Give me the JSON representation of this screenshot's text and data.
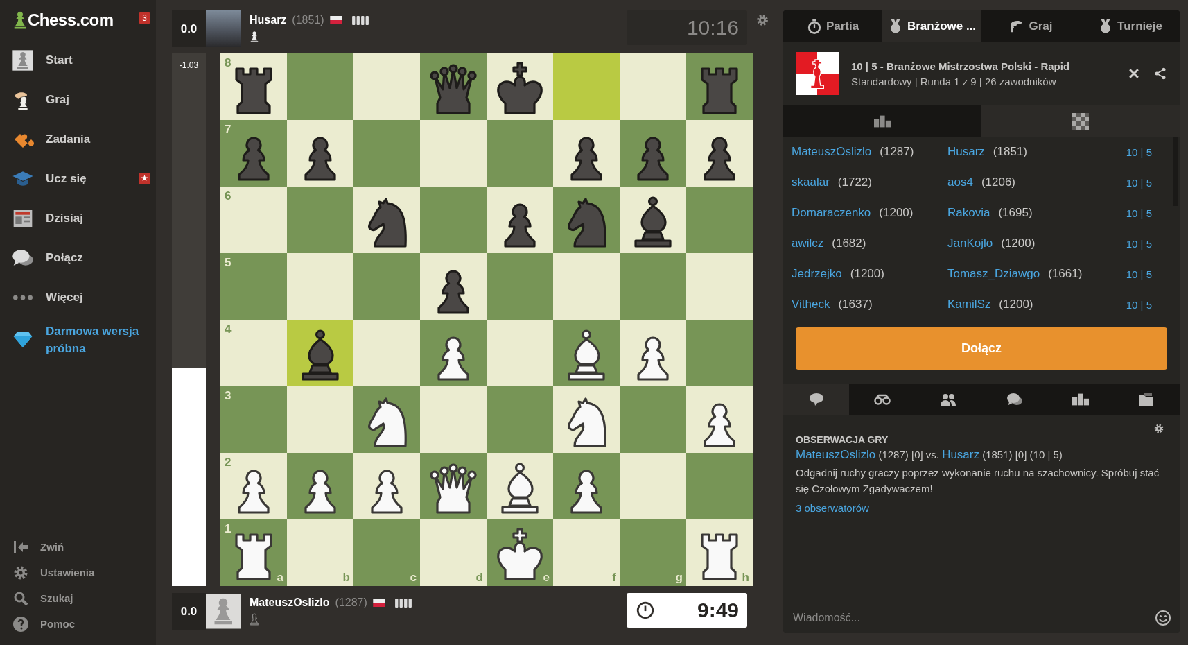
{
  "sidebar": {
    "logo": "Chess.com",
    "notification_count": "3",
    "items": [
      {
        "label": "Start",
        "starred": false
      },
      {
        "label": "Graj",
        "starred": false
      },
      {
        "label": "Zadania",
        "starred": false
      },
      {
        "label": "Ucz się",
        "starred": true
      },
      {
        "label": "Dzisiaj",
        "starred": false
      },
      {
        "label": "Połącz",
        "starred": false
      },
      {
        "label": "Więcej",
        "starred": false
      }
    ],
    "promo": "Darmowa wersja próbna",
    "footer": [
      {
        "label": "Zwiń"
      },
      {
        "label": "Ustawienia"
      },
      {
        "label": "Szukaj"
      },
      {
        "label": "Pomoc"
      }
    ]
  },
  "top_player": {
    "score": "0.0",
    "name": "Husarz",
    "rating": "(1851)",
    "clock": "10:16",
    "active": false
  },
  "eval_bar": {
    "reading": "-1.03",
    "level": 0.41
  },
  "board": {
    "rank_labels": [
      "8",
      "7",
      "6",
      "5",
      "4",
      "3",
      "2",
      "1"
    ],
    "file_labels": [
      "a",
      "b",
      "c",
      "d",
      "e",
      "f",
      "g",
      "h"
    ],
    "rows": [
      [
        {
          "kind": "rook",
          "white": false,
          "highlighted": false
        },
        {
          "highlighted": false
        },
        {
          "highlighted": false
        },
        {
          "kind": "queen",
          "white": false,
          "highlighted": false
        },
        {
          "kind": "king",
          "white": false,
          "highlighted": false
        },
        {
          "highlighted": true
        },
        {
          "highlighted": false
        },
        {
          "kind": "rook",
          "white": false,
          "highlighted": false
        }
      ],
      [
        {
          "kind": "pawn",
          "white": false,
          "highlighted": false
        },
        {
          "kind": "pawn",
          "white": false,
          "highlighted": false
        },
        {
          "highlighted": false
        },
        {
          "highlighted": false
        },
        {
          "highlighted": false
        },
        {
          "kind": "pawn",
          "white": false,
          "highlighted": false
        },
        {
          "kind": "pawn",
          "white": false,
          "highlighted": false
        },
        {
          "kind": "pawn",
          "white": false,
          "highlighted": false
        }
      ],
      [
        {
          "highlighted": false
        },
        {
          "highlighted": false
        },
        {
          "kind": "knight",
          "white": false,
          "highlighted": false
        },
        {
          "highlighted": false
        },
        {
          "kind": "pawn",
          "white": false,
          "highlighted": false
        },
        {
          "kind": "knight",
          "white": false,
          "highlighted": false
        },
        {
          "kind": "bishop",
          "white": false,
          "highlighted": false
        },
        {
          "highlighted": false
        }
      ],
      [
        {
          "highlighted": false
        },
        {
          "highlighted": false
        },
        {
          "highlighted": false
        },
        {
          "kind": "pawn",
          "white": false,
          "highlighted": false
        },
        {
          "highlighted": false
        },
        {
          "highlighted": false
        },
        {
          "highlighted": false
        },
        {
          "highlighted": false
        }
      ],
      [
        {
          "highlighted": false
        },
        {
          "kind": "bishop",
          "white": false,
          "highlighted": true
        },
        {
          "highlighted": false
        },
        {
          "kind": "pawn",
          "white": true,
          "highlighted": false
        },
        {
          "highlighted": false
        },
        {
          "kind": "bishop",
          "white": true,
          "highlighted": false
        },
        {
          "kind": "pawn",
          "white": true,
          "highlighted": false
        },
        {
          "highlighted": false
        }
      ],
      [
        {
          "highlighted": false
        },
        {
          "highlighted": false
        },
        {
          "kind": "knight",
          "white": true,
          "highlighted": false
        },
        {
          "highlighted": false
        },
        {
          "highlighted": false
        },
        {
          "kind": "knight",
          "white": true,
          "highlighted": false
        },
        {
          "highlighted": false
        },
        {
          "kind": "pawn",
          "white": true,
          "highlighted": false
        }
      ],
      [
        {
          "kind": "pawn",
          "white": true,
          "highlighted": false
        },
        {
          "kind": "pawn",
          "white": true,
          "highlighted": false
        },
        {
          "kind": "pawn",
          "white": true,
          "highlighted": false
        },
        {
          "kind": "queen",
          "white": true,
          "highlighted": false
        },
        {
          "kind": "bishop",
          "white": true,
          "highlighted": false
        },
        {
          "kind": "pawn",
          "white": true,
          "highlighted": false
        },
        {
          "highlighted": false
        },
        {
          "highlighted": false
        }
      ],
      [
        {
          "kind": "rook",
          "white": true,
          "highlighted": false
        },
        {
          "highlighted": false
        },
        {
          "highlighted": false
        },
        {
          "highlighted": false
        },
        {
          "kind": "king",
          "white": true,
          "highlighted": false
        },
        {
          "highlighted": false
        },
        {
          "highlighted": false
        },
        {
          "kind": "rook",
          "white": true,
          "highlighted": false
        }
      ]
    ]
  },
  "bottom_player": {
    "score": "0.0",
    "name": "MateuszOslizlo",
    "rating": "(1287)",
    "clock": "9:49",
    "active": true
  },
  "right_panel": {
    "tabs": [
      {
        "label": "Partia",
        "selected": false
      },
      {
        "label": "Branżowe ...",
        "selected": true
      },
      {
        "label": "Graj",
        "selected": false
      },
      {
        "label": "Turnieje",
        "selected": false
      }
    ],
    "tournament": {
      "title": "10 | 5 - Branżowe Mistrzostwa Polski - Rapid",
      "subtitle": "Standardowy | Runda 1 z 9 | 26 zawodników"
    },
    "subtabs": [
      {
        "selected": false
      },
      {
        "selected": true
      }
    ],
    "pairings": [
      {
        "white": "MateuszOslizlo",
        "white_rating": "(1287)",
        "black": "Husarz",
        "black_rating": "(1851)",
        "time": "10 | 5"
      },
      {
        "white": "skaalar",
        "white_rating": "(1722)",
        "black": "aos4",
        "black_rating": "(1206)",
        "time": "10 | 5"
      },
      {
        "white": "Domaraczenko",
        "white_rating": "(1200)",
        "black": "Rakovia",
        "black_rating": "(1695)",
        "time": "10 | 5"
      },
      {
        "white": "awilcz",
        "white_rating": "(1682)",
        "black": "JanKojlo",
        "black_rating": "(1200)",
        "time": "10 | 5"
      },
      {
        "white": "Jedrzejko",
        "white_rating": "(1200)",
        "black": "Tomasz_Dziawgo",
        "black_rating": "(1661)",
        "time": "10 | 5"
      },
      {
        "white": "Vitheck",
        "white_rating": "(1637)",
        "black": "KamilSz",
        "black_rating": "(1200)",
        "time": "10 | 5"
      }
    ],
    "join_button": "Dołącz",
    "chat_tabs": [
      {
        "selected": true
      },
      {
        "selected": false
      },
      {
        "selected": false
      },
      {
        "selected": false
      },
      {
        "selected": false
      },
      {
        "selected": false
      }
    ],
    "chat": {
      "heading": "OBSERWACJA GRY",
      "white": "MateuszOslizlo",
      "white_info": "(1287) [0] vs.",
      "black": "Husarz",
      "black_info": "(1851) [0] (10 | 5)",
      "message": "Odgadnij ruchy graczy poprzez wykonanie ruchu na szachownicy. Spróbuj stać się Czołowym Zgadywaczem!",
      "watchers": "3 obserwatorów",
      "placeholder": "Wiadomość..."
    }
  }
}
